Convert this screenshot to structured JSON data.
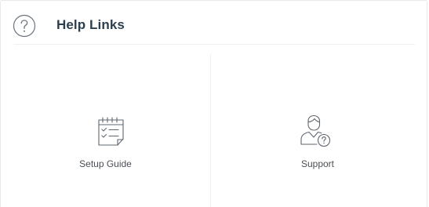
{
  "header": {
    "title": "Help Links",
    "icon": "question-circle-icon"
  },
  "tiles": [
    {
      "label": "Setup Guide",
      "icon": "checklist-document-icon"
    },
    {
      "label": "Support",
      "icon": "user-question-icon"
    }
  ],
  "colors": {
    "title": "#2b3f50",
    "label": "#4a4f55",
    "icon_stroke": "#5f6770",
    "border": "#e7e9ec"
  }
}
